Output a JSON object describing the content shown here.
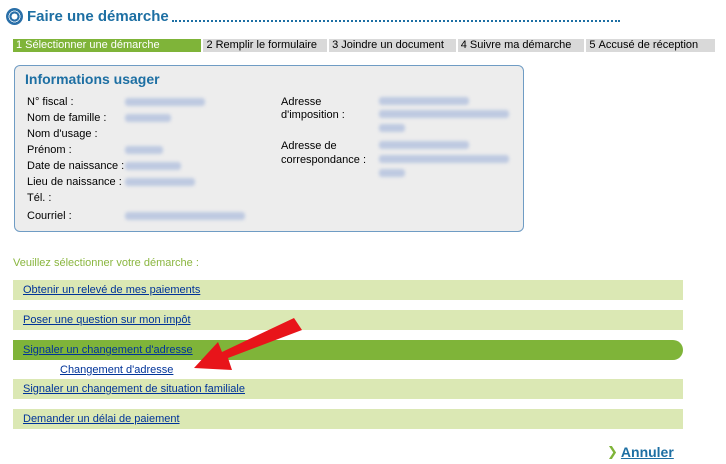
{
  "header": {
    "title": "Faire une démarche",
    "logo_icon": "dgfip-emblem-icon"
  },
  "steps": [
    {
      "num": "1",
      "label": "Sélectionner une démarche",
      "active": true
    },
    {
      "num": "2",
      "label": "Remplir le formulaire",
      "active": false
    },
    {
      "num": "3",
      "label": "Joindre un document",
      "active": false
    },
    {
      "num": "4",
      "label": "Suivre ma démarche",
      "active": false
    },
    {
      "num": "5",
      "label": "Accusé de réception",
      "active": false
    }
  ],
  "info": {
    "title": "Informations usager",
    "labels": {
      "fiscal": "N° fiscal :",
      "nom_famille": "Nom de famille :",
      "nom_usage": "Nom d'usage :",
      "prenom": "Prénom :",
      "date_naissance": "Date de naissance :",
      "lieu_naissance": "Lieu de naissance :",
      "tel": "Tél. :",
      "courriel": "Courriel :",
      "adresse_imposition_1": "Adresse",
      "adresse_imposition_2": "d'imposition :",
      "adresse_corresp_1": "Adresse de",
      "adresse_corresp_2": "correspondance :"
    }
  },
  "selection": {
    "prompt": "Veuillez sélectionner votre démarche :",
    "options": [
      "Obtenir un relevé de mes paiements",
      "Poser une question sur mon impôt",
      "Signaler un changement d'adresse",
      "Signaler un changement de situation familiale",
      "Demander un délai de paiement"
    ],
    "selected_sub": "Changement d'adresse"
  },
  "footer": {
    "cancel_label": "Annuler",
    "cancel_icon": "chevron-right-icon"
  },
  "colors": {
    "brand_blue": "#1d6fa3",
    "accent_green": "#7fb439",
    "option_bg": "#dbe8b4",
    "arrow_red": "#e8141a"
  }
}
